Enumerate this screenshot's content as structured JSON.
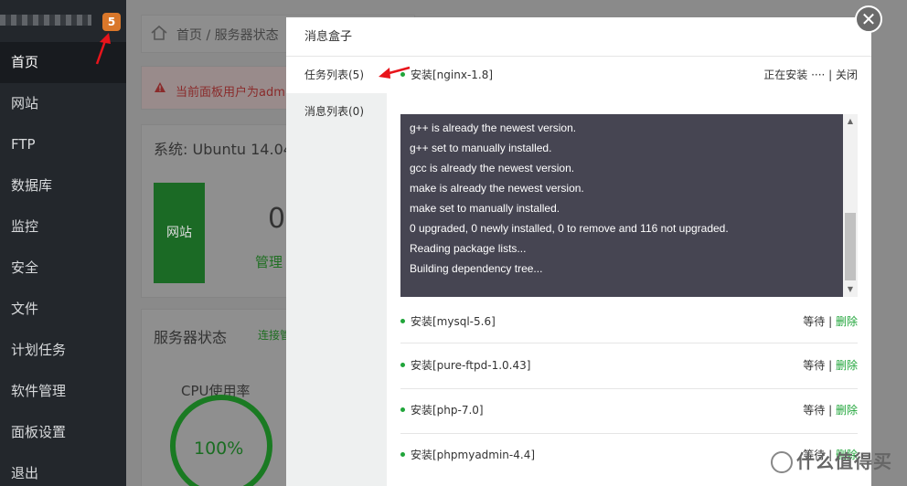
{
  "sidebar": {
    "badge": "5",
    "items": [
      {
        "label": "首页",
        "active": true
      },
      {
        "label": "网站"
      },
      {
        "label": "FTP"
      },
      {
        "label": "数据库"
      },
      {
        "label": "监控"
      },
      {
        "label": "安全"
      },
      {
        "label": "文件"
      },
      {
        "label": "计划任务"
      },
      {
        "label": "软件管理"
      },
      {
        "label": "面板设置"
      },
      {
        "label": "退出"
      }
    ]
  },
  "background": {
    "breadcrumb": "首页 / 服务器状态",
    "warning": "当前面板用户为admin",
    "system": "系统: Ubuntu 14.04",
    "site_box": "网站",
    "site_count": "0",
    "manage": "管理",
    "server_status": "服务器状态",
    "connect": "连接管",
    "cpu_label": "CPU使用率",
    "cpu_value": "100%"
  },
  "modal": {
    "title": "消息盒子",
    "tabs": [
      {
        "label": "任务列表(5)",
        "active": true
      },
      {
        "label": "消息列表(0)"
      }
    ],
    "current_task": {
      "name": "安装[nginx-1.8]",
      "status": "正在安装 ···· | 关闭"
    },
    "console_lines": [
      "g++ is already the newest version.",
      "g++ set to manually installed.",
      "gcc is already the newest version.",
      "make is already the newest version.",
      "make set to manually installed.",
      "0 upgraded, 0 newly installed, 0 to remove and 116 not upgraded.",
      "Reading package lists...",
      "Building dependency tree..."
    ],
    "queued_tasks": [
      {
        "name": "安装[mysql-5.6]",
        "status": "等待",
        "action": "删除"
      },
      {
        "name": "安装[pure-ftpd-1.0.43]",
        "status": "等待",
        "action": "删除"
      },
      {
        "name": "安装[php-7.0]",
        "status": "等待",
        "action": "删除"
      },
      {
        "name": "安装[phpmyadmin-4.4]",
        "status": "等待",
        "action": "删除"
      }
    ],
    "close": "✕"
  },
  "watermark": "什么值得买",
  "colors": {
    "accent_green": "#20a53a",
    "sidebar_bg": "#23272c",
    "badge": "#d9772a",
    "console_bg": "#464552"
  }
}
